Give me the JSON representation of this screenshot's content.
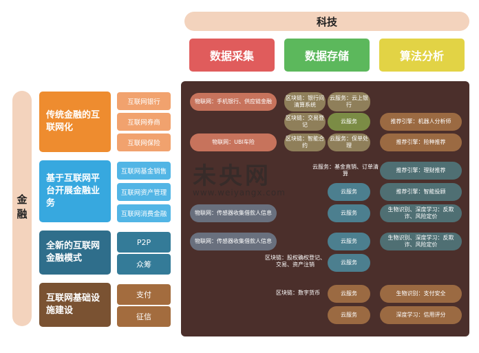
{
  "header": {
    "tech_label": "科技",
    "top_boxes": [
      {
        "label": "数据采集",
        "color": "#e05c5c"
      },
      {
        "label": "数据存储",
        "color": "#5cb85c"
      },
      {
        "label": "算法分析",
        "color": "#e2d345"
      }
    ]
  },
  "finance": {
    "label": "金融",
    "categories": [
      {
        "title": "传统金融的互联网化",
        "color": "#ee8c2f",
        "subs": [
          "互联网银行",
          "互联网券商",
          "互联网保险"
        ],
        "sub_color": "#f1a26e"
      },
      {
        "title": "基于互联网平台开展金融业务",
        "color": "#37a8df",
        "subs": [
          "互联网基金销售",
          "互联网资产管理",
          "互联网消费金融"
        ],
        "sub_color": "#52b5e5"
      },
      {
        "title": "全新的互联网金融模式",
        "color": "#2f6e8b",
        "subs": [
          "P2P",
          "众筹"
        ],
        "sub_color": "#347b98"
      },
      {
        "title": "互联网基础设施建设",
        "color": "#7a5232",
        "subs": [
          "支付",
          "征信"
        ],
        "sub_color": "#a36c3e"
      }
    ]
  },
  "panel": {
    "iot": [
      "物联网：手机银行、供应链金融",
      "物联网：UBI车险",
      "物联网：传感器收集借款人信息",
      "物联网：传感器收集借款人信息"
    ],
    "blockchain": [
      "区块链：银行间清算系统",
      "区块链：交易登记",
      "区块链：智能合约",
      "区块链：股权确权登记、交易、资产注销",
      "区块链：数字货币"
    ],
    "cloud": [
      "云服务：云上银行",
      "云服务",
      "云服务：保单处理",
      "云服务：基金直销、订单清算",
      "云服务",
      "云服务",
      "云服务",
      "云服务",
      "云服务",
      "云服务"
    ],
    "ai": [
      "推荐引擎：机器人分析师",
      "推荐引擎：险种推荐",
      "推荐引擎：理财推荐",
      "推荐引擎：智能投顾",
      "生物识别、深度学习：反欺诈、风险定价",
      "生物识别、深度学习：反欺诈、风险定价",
      "生物识别：支付安全",
      "深度学习：信用评分"
    ]
  },
  "watermark": {
    "cn": "未央网",
    "en": "www.weiyangx.com"
  }
}
